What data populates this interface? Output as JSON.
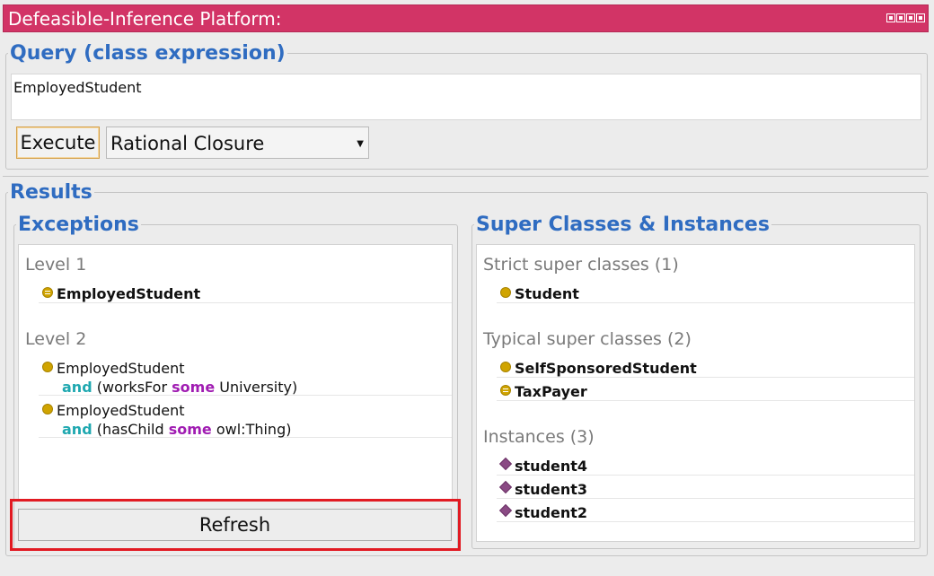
{
  "window": {
    "title": "Defeasible-Inference Platform:"
  },
  "query": {
    "legend": "Query (class expression)",
    "value": "EmployedStudent",
    "execute_label": "Execute",
    "mode_selected": "Rational Closure"
  },
  "results": {
    "legend": "Results",
    "exceptions": {
      "legend": "Exceptions",
      "level1_label": "Level 1",
      "level1_items": [
        "EmployedStudent"
      ],
      "level2_label": "Level 2",
      "level2_items": [
        {
          "line1": "EmployedStudent",
          "kw_and": "and",
          "pre": "(worksFor",
          "kw_some": "some",
          "post": "University)"
        },
        {
          "line1": "EmployedStudent",
          "kw_and": "and",
          "pre": "(hasChild",
          "kw_some": "some",
          "post": "owl:Thing)"
        }
      ],
      "refresh_label": "Refresh"
    },
    "super": {
      "legend": "Super Classes & Instances",
      "strict_label": "Strict super classes (1)",
      "strict_items": [
        "Student"
      ],
      "typical_label": "Typical super classes (2)",
      "typical_items": [
        "SelfSponsoredStudent",
        "TaxPayer"
      ],
      "instances_label": "Instances (3)",
      "instances_items": [
        "student4",
        "student3",
        "student2"
      ]
    }
  }
}
